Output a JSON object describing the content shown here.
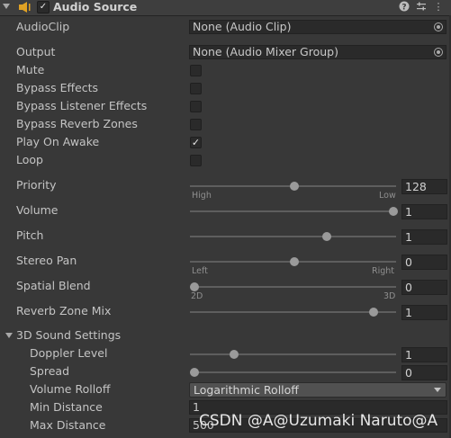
{
  "component": {
    "title": "Audio Source",
    "enabled": true,
    "icon": "speaker-icon",
    "header_buttons": [
      "help-icon",
      "preset-icon",
      "menu-icon"
    ]
  },
  "fields": {
    "audio_clip": {
      "label": "AudioClip",
      "value": "None (Audio Clip)"
    },
    "output": {
      "label": "Output",
      "value": "None (Audio Mixer Group)"
    }
  },
  "toggles": [
    {
      "label": "Mute",
      "checked": false
    },
    {
      "label": "Bypass Effects",
      "checked": false
    },
    {
      "label": "Bypass Listener Effects",
      "checked": false
    },
    {
      "label": "Bypass Reverb Zones",
      "checked": false
    },
    {
      "label": "Play On Awake",
      "checked": true
    },
    {
      "label": "Loop",
      "checked": false
    }
  ],
  "sliders": {
    "priority": {
      "label": "Priority",
      "value": "128",
      "fraction": 0.5,
      "left_label": "High",
      "right_label": "Low"
    },
    "volume": {
      "label": "Volume",
      "value": "1",
      "fraction": 1.0
    },
    "pitch": {
      "label": "Pitch",
      "value": "1",
      "fraction": 0.667
    },
    "stereo_pan": {
      "label": "Stereo Pan",
      "value": "0",
      "fraction": 0.5,
      "left_label": "Left",
      "right_label": "Right"
    },
    "spatial_blend": {
      "label": "Spatial Blend",
      "value": "0",
      "fraction": 0.0,
      "left_label": "2D",
      "right_label": "3D"
    },
    "reverb_zone_mix": {
      "label": "Reverb Zone Mix",
      "value": "1",
      "fraction": 0.9
    }
  },
  "sound3d": {
    "label": "3D Sound Settings",
    "doppler_level": {
      "label": "Doppler Level",
      "value": "1",
      "fraction": 0.2
    },
    "spread": {
      "label": "Spread",
      "value": "0",
      "fraction": 0.0
    },
    "volume_rolloff": {
      "label": "Volume Rolloff",
      "value": "Logarithmic Rolloff"
    },
    "min_distance": {
      "label": "Min Distance",
      "value": "1"
    },
    "max_distance": {
      "label": "Max Distance",
      "value": "500"
    }
  },
  "watermark": "CSDN @A@Uzumaki Naruto@A"
}
